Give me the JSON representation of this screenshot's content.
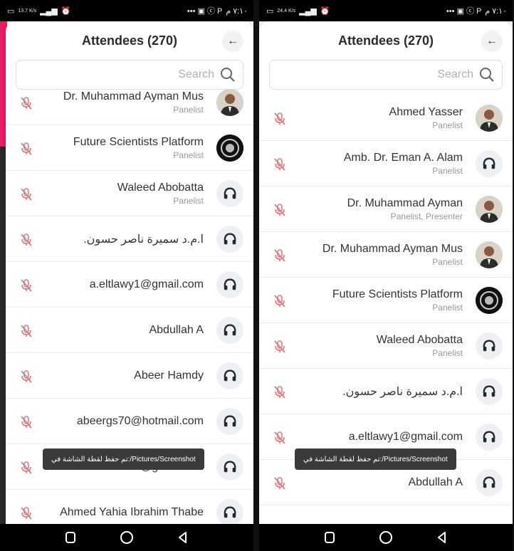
{
  "status": {
    "left_speed": "13.7 K/s",
    "right_speed": "24.4 K/s",
    "time": "٧:١٠ م",
    "indicators": "••• ▣ ⓒ P"
  },
  "screen": {
    "title": "Attendees (270)",
    "search_placeholder": "Search"
  },
  "left_rows": [
    {
      "name": "Dr. Muhammad Ayman Mus",
      "role": "Panelist",
      "avatar": "photo"
    },
    {
      "name": "Future Scientists Platform",
      "role": "Panelist",
      "avatar": "logo"
    },
    {
      "name": "Waleed Abobatta",
      "role": "Panelist",
      "avatar": "headphones-icon"
    },
    {
      "name": ".ا.م.د سميرة ناصر حسون",
      "role": "",
      "avatar": "headphones-icon"
    },
    {
      "name": "a.eltlawy1@gmail.com",
      "role": "",
      "avatar": "headphones-icon"
    },
    {
      "name": "Abdullah A",
      "role": "",
      "avatar": "headphones-icon"
    },
    {
      "name": "Abeer Hamdy",
      "role": "",
      "avatar": "headphones-icon"
    },
    {
      "name": "abeergs70@hotmail.com",
      "role": "",
      "avatar": "headphones-icon"
    },
    {
      "name": "afrah.alam@gmail.com",
      "role": "",
      "avatar": "headphones-icon"
    },
    {
      "name": "Ahmed Yahia Ibrahim Thabe",
      "role": "",
      "avatar": "headphones-icon"
    }
  ],
  "right_rows": [
    {
      "name": "Ahmed Yasser",
      "role": "Panelist",
      "avatar": "photo"
    },
    {
      "name": "Amb. Dr. Eman A. Alam",
      "role": "Panelist",
      "avatar": "headphones-icon"
    },
    {
      "name": "Dr. Muhammad Ayman",
      "role": "Panelist, Presenter",
      "avatar": "photo"
    },
    {
      "name": "Dr. Muhammad Ayman Mus",
      "role": "Panelist",
      "avatar": "photo"
    },
    {
      "name": "Future Scientists Platform",
      "role": "Panelist",
      "avatar": "logo"
    },
    {
      "name": "Waleed Abobatta",
      "role": "Panelist",
      "avatar": "headphones-icon"
    },
    {
      "name": ".ا.م.د سميرة ناصر حسون",
      "role": "",
      "avatar": "headphones-icon"
    },
    {
      "name": "a.eltlawy1@gmail.com",
      "role": "",
      "avatar": "headphones-icon"
    },
    {
      "name": "Abdullah A",
      "role": "",
      "avatar": "headphones-icon"
    }
  ],
  "toast_text": "تم حفظ لقطة الشاشة في:/Pictures/Screenshot",
  "colors": {
    "accent": "#e91e63",
    "muted_mic": "#e07a7a",
    "headphone": "#1f2a36"
  }
}
